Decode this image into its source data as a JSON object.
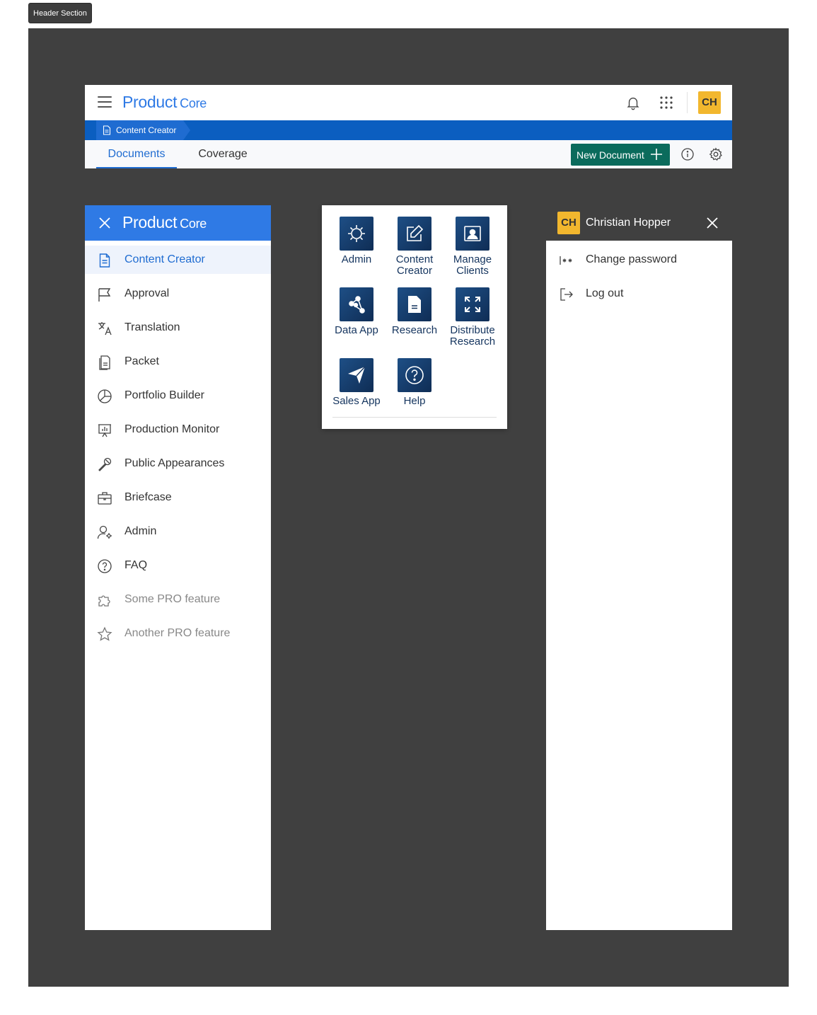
{
  "section_tag": "Header Section",
  "header": {
    "logo_main": "Product",
    "logo_sub": "Core",
    "avatar_initials": "CH",
    "breadcrumb": "Content Creator",
    "tabs": [
      {
        "label": "Documents",
        "active": true
      },
      {
        "label": "Coverage",
        "active": false
      }
    ],
    "new_document_label": "New Document"
  },
  "sidenav": {
    "logo_main": "Product",
    "logo_sub": "Core",
    "items": [
      {
        "label": "Content Creator",
        "icon": "document-icon",
        "active": true
      },
      {
        "label": "Approval",
        "icon": "flag-icon"
      },
      {
        "label": "Translation",
        "icon": "translate-icon"
      },
      {
        "label": "Packet",
        "icon": "packet-icon"
      },
      {
        "label": "Portfolio Builder",
        "icon": "pie-chart-icon"
      },
      {
        "label": "Production Monitor",
        "icon": "presentation-chart-icon"
      },
      {
        "label": "Public Appearances",
        "icon": "microphone-icon"
      },
      {
        "label": "Briefcase",
        "icon": "briefcase-icon"
      },
      {
        "label": "Admin",
        "icon": "user-gear-icon"
      },
      {
        "label": "FAQ",
        "icon": "help-circle-icon"
      },
      {
        "label": "Some PRO feature",
        "icon": "puzzle-icon",
        "pro": true
      },
      {
        "label": "Another PRO feature",
        "icon": "star-icon",
        "pro": true
      }
    ]
  },
  "apps_menu": {
    "apps": [
      {
        "label": "Admin",
        "icon": "gear-icon"
      },
      {
        "label": "Content Creator",
        "icon": "edit-icon"
      },
      {
        "label": "Manage Clients",
        "icon": "portrait-icon"
      },
      {
        "label": "Data App",
        "icon": "network-icon"
      },
      {
        "label": "Research",
        "icon": "document-icon"
      },
      {
        "label": "Distribute Research",
        "icon": "expand-icon"
      },
      {
        "label": "Sales App",
        "icon": "send-icon"
      },
      {
        "label": "Help",
        "icon": "help-circle-icon"
      }
    ]
  },
  "user_panel": {
    "initials": "CH",
    "name": "Christian Hopper",
    "items": [
      {
        "label": "Change password",
        "icon": "password-icon"
      },
      {
        "label": "Log out",
        "icon": "logout-icon"
      }
    ]
  },
  "colors": {
    "brand_blue": "#2f7ae5",
    "breadcrumb_bar": "#0b5ec0",
    "primary_green": "#0b6b5c",
    "avatar_yellow": "#f2b72e",
    "app_tile_navy": "#14345e",
    "frame_dark": "#404040"
  }
}
